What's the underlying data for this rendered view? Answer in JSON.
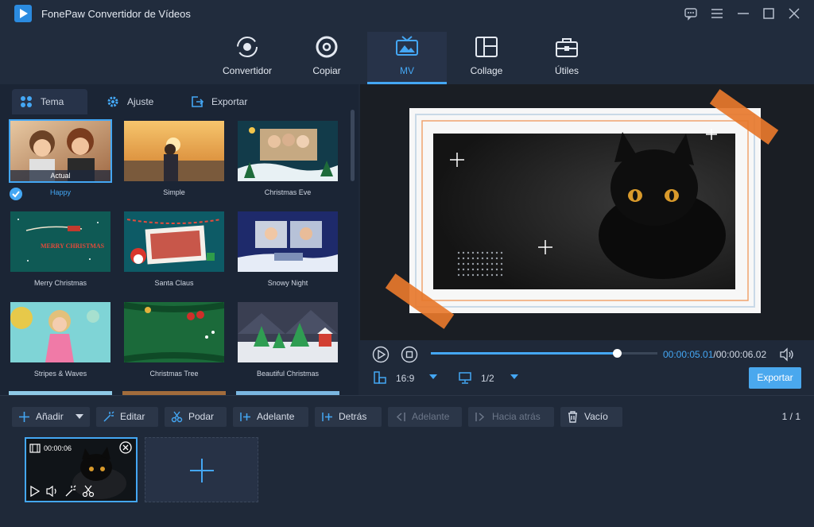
{
  "app": {
    "title": "FonePaw Convertidor de Vídeos"
  },
  "nav": [
    {
      "label": "Convertidor",
      "icon": "convert-icon"
    },
    {
      "label": "Copiar",
      "icon": "disc-icon"
    },
    {
      "label": "MV",
      "icon": "mv-icon",
      "active": true
    },
    {
      "label": "Collage",
      "icon": "collage-icon"
    },
    {
      "label": "Útiles",
      "icon": "toolbox-icon"
    }
  ],
  "tabs": [
    {
      "label": "Tema",
      "icon": "grid-icon",
      "active": true
    },
    {
      "label": "Ajuste",
      "icon": "gear-icon"
    },
    {
      "label": "Exportar",
      "icon": "export-icon"
    }
  ],
  "themes": [
    {
      "name": "Happy",
      "badge": "Actual",
      "selected": true
    },
    {
      "name": "Simple"
    },
    {
      "name": "Christmas Eve"
    },
    {
      "name": "Merry Christmas",
      "art_text": "MERRY CHRISTMAS"
    },
    {
      "name": "Santa Claus"
    },
    {
      "name": "Snowy Night"
    },
    {
      "name": "Stripes & Waves"
    },
    {
      "name": "Christmas Tree"
    },
    {
      "name": "Beautiful Christmas"
    }
  ],
  "player": {
    "current_time": "00:00:05.01",
    "total_time": "/00:00:06.02",
    "progress": 0.82,
    "aspect_ratio": "16:9",
    "quality": "1/2",
    "export_label": "Exportar"
  },
  "toolbar": {
    "add": "Añadir",
    "edit": "Editar",
    "trim": "Podar",
    "forward": "Adelante",
    "behind": "Detrás",
    "forward2": "Adelante",
    "backward": "Hacia atrás",
    "empty": "Vacío",
    "page": "1 / 1"
  },
  "clip": {
    "duration": "00:00:06"
  },
  "colors": {
    "accent": "#44a7f4",
    "bg": "#1f2939",
    "panel": "#1b2535",
    "tape": "#e7782c"
  }
}
